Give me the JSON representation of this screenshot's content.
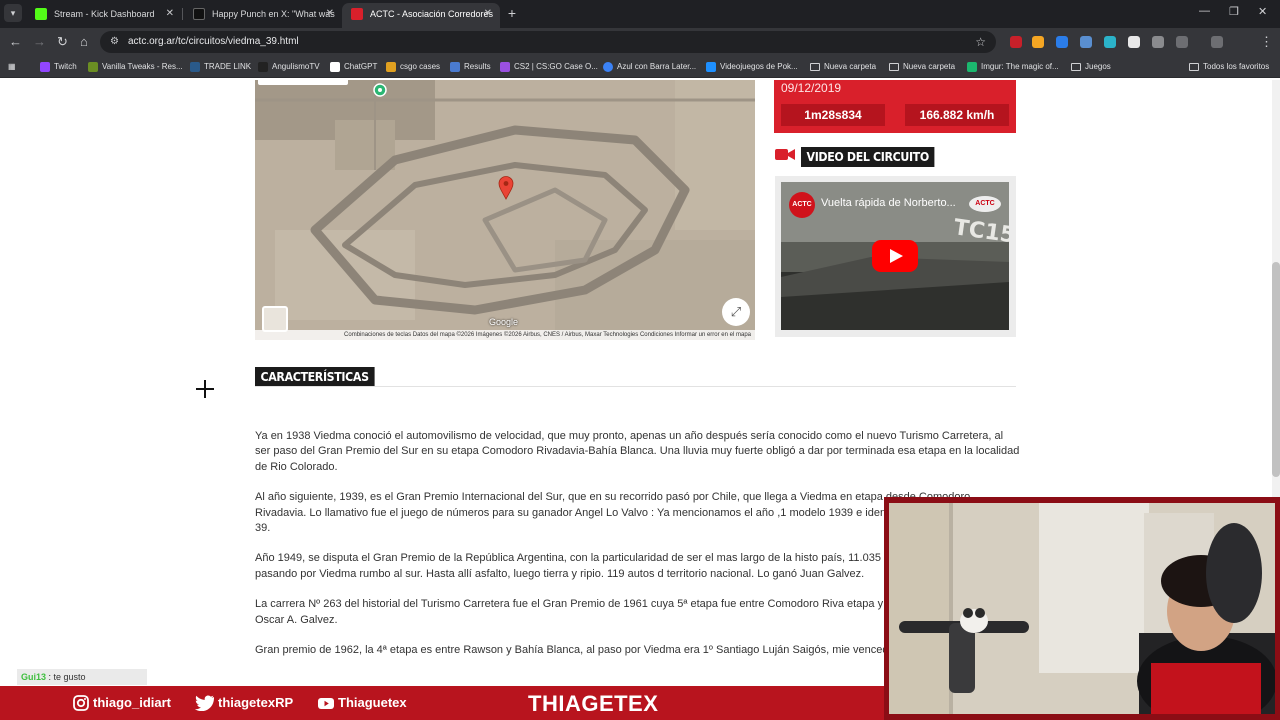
{
  "browser": {
    "tabs": [
      {
        "title": "Stream - Kick Dashboard",
        "favicon_color": "#53fc18",
        "active": false
      },
      {
        "title": "Happy Punch en X: \"What was",
        "favicon_color": "#111111",
        "active": false
      },
      {
        "title": "ACTC - Asociación Corredores",
        "favicon_color": "#d9202b",
        "active": true
      }
    ],
    "url": "actc.org.ar/tc/circuitos/viedma_39.html",
    "profile_initial": "T",
    "bookmarks": [
      {
        "label": "Twitch",
        "color": "#9146ff",
        "type": "site"
      },
      {
        "label": "Vanilla Tweaks - Res...",
        "color": "#6b8e23",
        "type": "site"
      },
      {
        "label": "TRADE LINK",
        "color": "#2a5a8a",
        "type": "site"
      },
      {
        "label": "AngulismoTV",
        "color": "#222222",
        "type": "site"
      },
      {
        "label": "ChatGPT",
        "color": "#ffffff",
        "type": "site"
      },
      {
        "label": "csgo cases",
        "color": "#e0a020",
        "type": "site"
      },
      {
        "label": "Results",
        "color": "#4a7bd0",
        "type": "site"
      },
      {
        "label": "CS2 | CS:GO Case O...",
        "color": "#9a50e0",
        "type": "site"
      },
      {
        "label": "Azul con Barra Later...",
        "color": "#3b82f6",
        "type": "site"
      },
      {
        "label": "Videojuegos de Pok...",
        "color": "#1e90ff",
        "type": "site"
      },
      {
        "label": "Nueva carpeta",
        "type": "folder"
      },
      {
        "label": "Nueva carpeta",
        "type": "folder"
      },
      {
        "label": "Imgur: The magic of...",
        "color": "#1bb76e",
        "type": "site"
      },
      {
        "label": "Juegos",
        "type": "folder"
      }
    ],
    "all_bookmarks": "Todos los favoritos"
  },
  "map": {
    "attribution": "Combinaciones de teclas   Datos del mapa ©2026 Imágenes ©2026 Airbus, CNES / Airbus, Maxar Technologies   Condiciones   Informar un error en el mapa",
    "logo": "Google"
  },
  "record": {
    "date": "09/12/2019",
    "time": "1m28s834",
    "speed": "166.882 km/h"
  },
  "video_section": {
    "heading": "VIDEO DEL CIRCUITO",
    "video_title": "Vuelta rápida de Norberto...",
    "channel": "ACTC"
  },
  "features": {
    "heading": "CARACTERÍSTICAS",
    "paragraphs": [
      "Ya en 1938 Viedma conoció el automovilismo de velocidad, que muy pronto, apenas un año después sería conocido como el nuevo Turismo Carretera, al ser paso del Gran Premio del Sur en su etapa Comodoro Rivadavia-Bahía Blanca. Una lluvia muy fuerte obligó a dar por terminada esa etapa en la localidad de Rio Colorado.",
      "Al año siguiente, 1939, es el Gran Premio Internacional del Sur, que en su recorrido pasó por Chile, que llega a Viedma en etapa desde Comodoro Rivadavia. Lo llamativo fue el juego de números para su ganador Angel Lo Valvo : Ya mencionamos el año ,1 modelo 1939 e identificada la unidad con el Nº 39.",
      "Año 1949, se disputa el Gran Premio de la República Argentina,      con la particularidad de ser el mas  largo de la histo país,  11.035 kms, , durante 22 días, pasando por Viedma rumbo al sur. Hasta  allí asfalto, luego tierra y ripio. 119  autos d territorio nacional. Lo ganó Juan Galvez.",
      "La carrera Nº 263 del historial del Turismo Carretera fue el Gran Premio de 1961 cuya 5ª etapa fue entre Comodoro Riva etapa y G.P., vieron triunfador a Oscar A. Galvez.",
      "Gran premio de 1962, la 4ª etapa es entre Rawson y Bahía Blanca, al paso por Viedma era 1º Santiago Luján Saigós, mie vencedor Félix Alberto Peduzzi."
    ]
  },
  "overlay": {
    "chat_user": "Gui13",
    "chat_message": "te gusto",
    "instagram": "thiago_idiart",
    "twitter": "thiagetexRP",
    "youtube": "Thiaguetex",
    "brand": "THIAGETEX"
  }
}
